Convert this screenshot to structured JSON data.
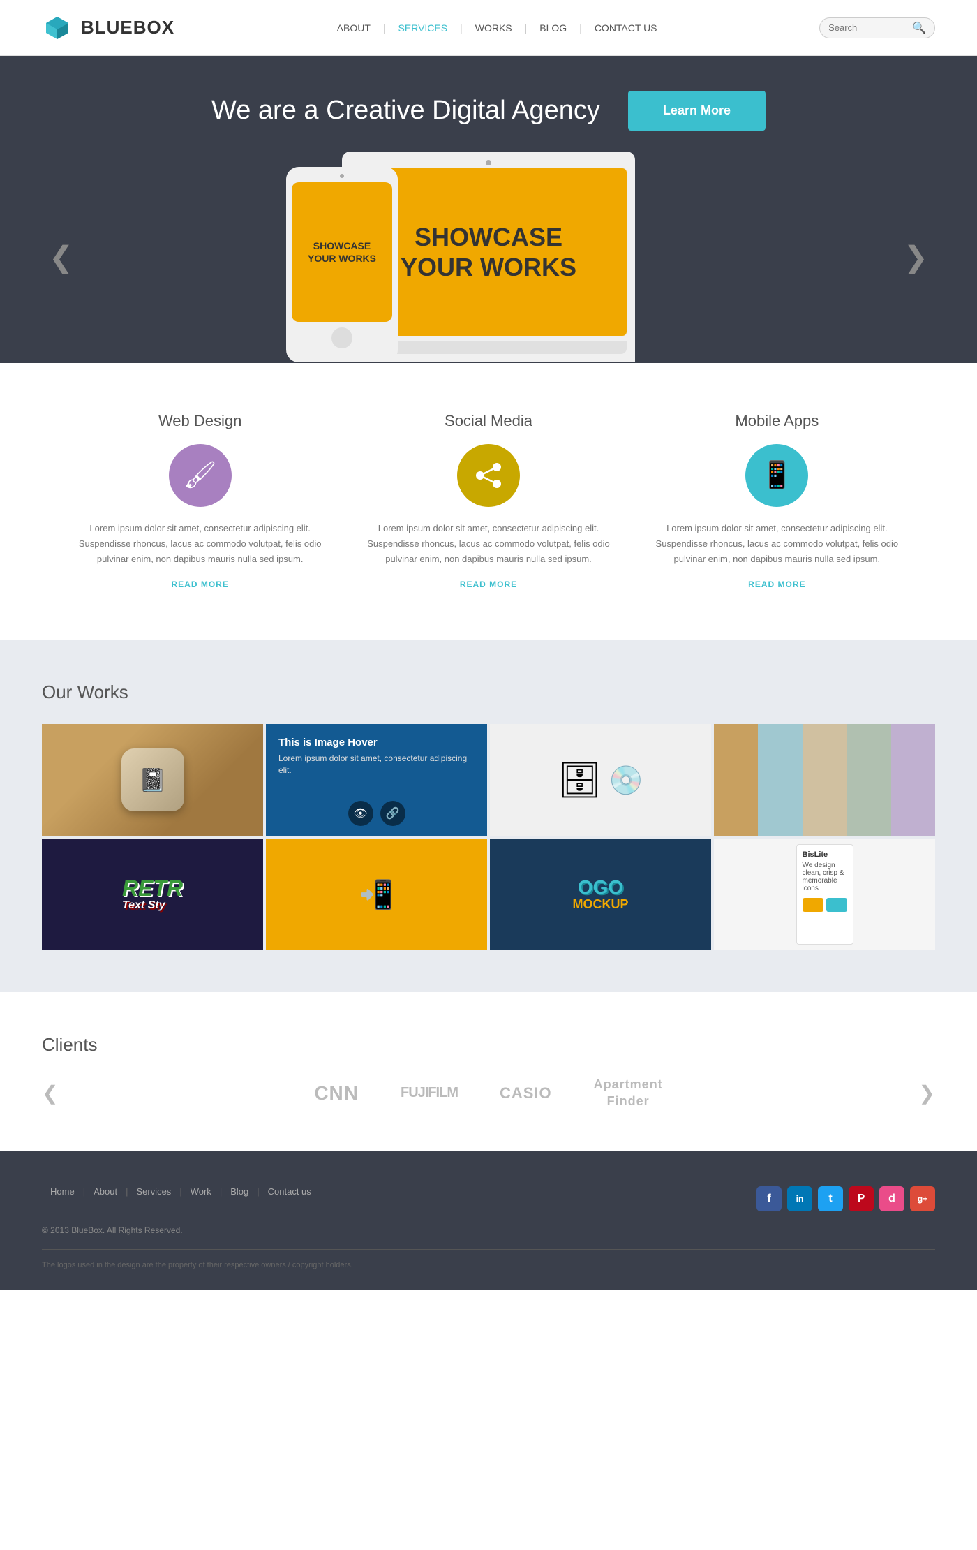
{
  "header": {
    "logo_text": "BLUEBOX",
    "nav_items": [
      {
        "label": "ABOUT",
        "active": false
      },
      {
        "label": "SERVICES",
        "active": true
      },
      {
        "label": "WORKS",
        "active": false
      },
      {
        "label": "BLOG",
        "active": false
      },
      {
        "label": "CONTACT US",
        "active": false
      }
    ],
    "search_placeholder": "Search"
  },
  "hero": {
    "title": "We are a Creative Digital Agency",
    "learn_more": "Learn More",
    "arrow_left": "❮",
    "arrow_right": "❯",
    "showcase_line1": "SHOWCASE",
    "showcase_line2": "YOUR WORKS",
    "phone_line1": "SHOWCASE",
    "phone_line2": "YOUR WORKS"
  },
  "services": {
    "items": [
      {
        "title": "Web Design",
        "icon": "🖌",
        "icon_class": "icon-purple",
        "description": "Lorem ipsum dolor sit amet, consectetur adipiscing elit. Suspendisse rhoncus, lacus ac commodo volutpat, felis odio pulvinar enim, non dapibus mauris nulla sed ipsum.",
        "read_more": "READ MORE"
      },
      {
        "title": "Social Media",
        "icon": "↗",
        "icon_class": "icon-yellow",
        "description": "Lorem ipsum dolor sit amet, consectetur adipiscing elit. Suspendisse rhoncus, lacus ac commodo volutpat, felis odio pulvinar enim, non dapibus mauris nulla sed ipsum.",
        "read_more": "READ MORE"
      },
      {
        "title": "Mobile Apps",
        "icon": "📱",
        "icon_class": "icon-teal",
        "description": "Lorem ipsum dolor sit amet, consectetur adipiscing elit. Suspendisse rhoncus, lacus ac commodo volutpat, felis odio pulvinar enim, non dapibus mauris nulla sed ipsum.",
        "read_more": "READ MORE"
      }
    ]
  },
  "works": {
    "section_title": "Our Works",
    "hover_title": "This is Image Hover",
    "hover_desc": "Lorem ipsum dolor sit amet, consectetur adipiscing elit.",
    "items": [
      {
        "id": 1,
        "type": "notepad"
      },
      {
        "id": 2,
        "type": "hover"
      },
      {
        "id": 3,
        "type": "database"
      },
      {
        "id": 4,
        "type": "gradient"
      },
      {
        "id": 5,
        "type": "retro"
      },
      {
        "id": 6,
        "type": "tablet"
      },
      {
        "id": 7,
        "type": "logo"
      },
      {
        "id": 8,
        "type": "website"
      }
    ]
  },
  "clients": {
    "section_title": "Clients",
    "logos": [
      "CNN",
      "FUJIFILM",
      "CASIO",
      "Apartment\nFinder"
    ],
    "arrow_left": "❮",
    "arrow_right": "❯"
  },
  "footer": {
    "links": [
      "Home",
      "About",
      "Services",
      "Work",
      "Blog",
      "Contact us"
    ],
    "copyright": "© 2013 BlueBox. All Rights Reserved.",
    "disclaimer": "The logos used in the design are the property of their respective owners / copyright holders.",
    "social": [
      {
        "label": "f",
        "class": "fb",
        "name": "facebook"
      },
      {
        "label": "in",
        "class": "li",
        "name": "linkedin"
      },
      {
        "label": "t",
        "class": "tw",
        "name": "twitter"
      },
      {
        "label": "P",
        "class": "pi",
        "name": "pinterest"
      },
      {
        "label": "d",
        "class": "dr",
        "name": "dribbble"
      },
      {
        "label": "g+",
        "class": "gp",
        "name": "googleplus"
      }
    ]
  }
}
